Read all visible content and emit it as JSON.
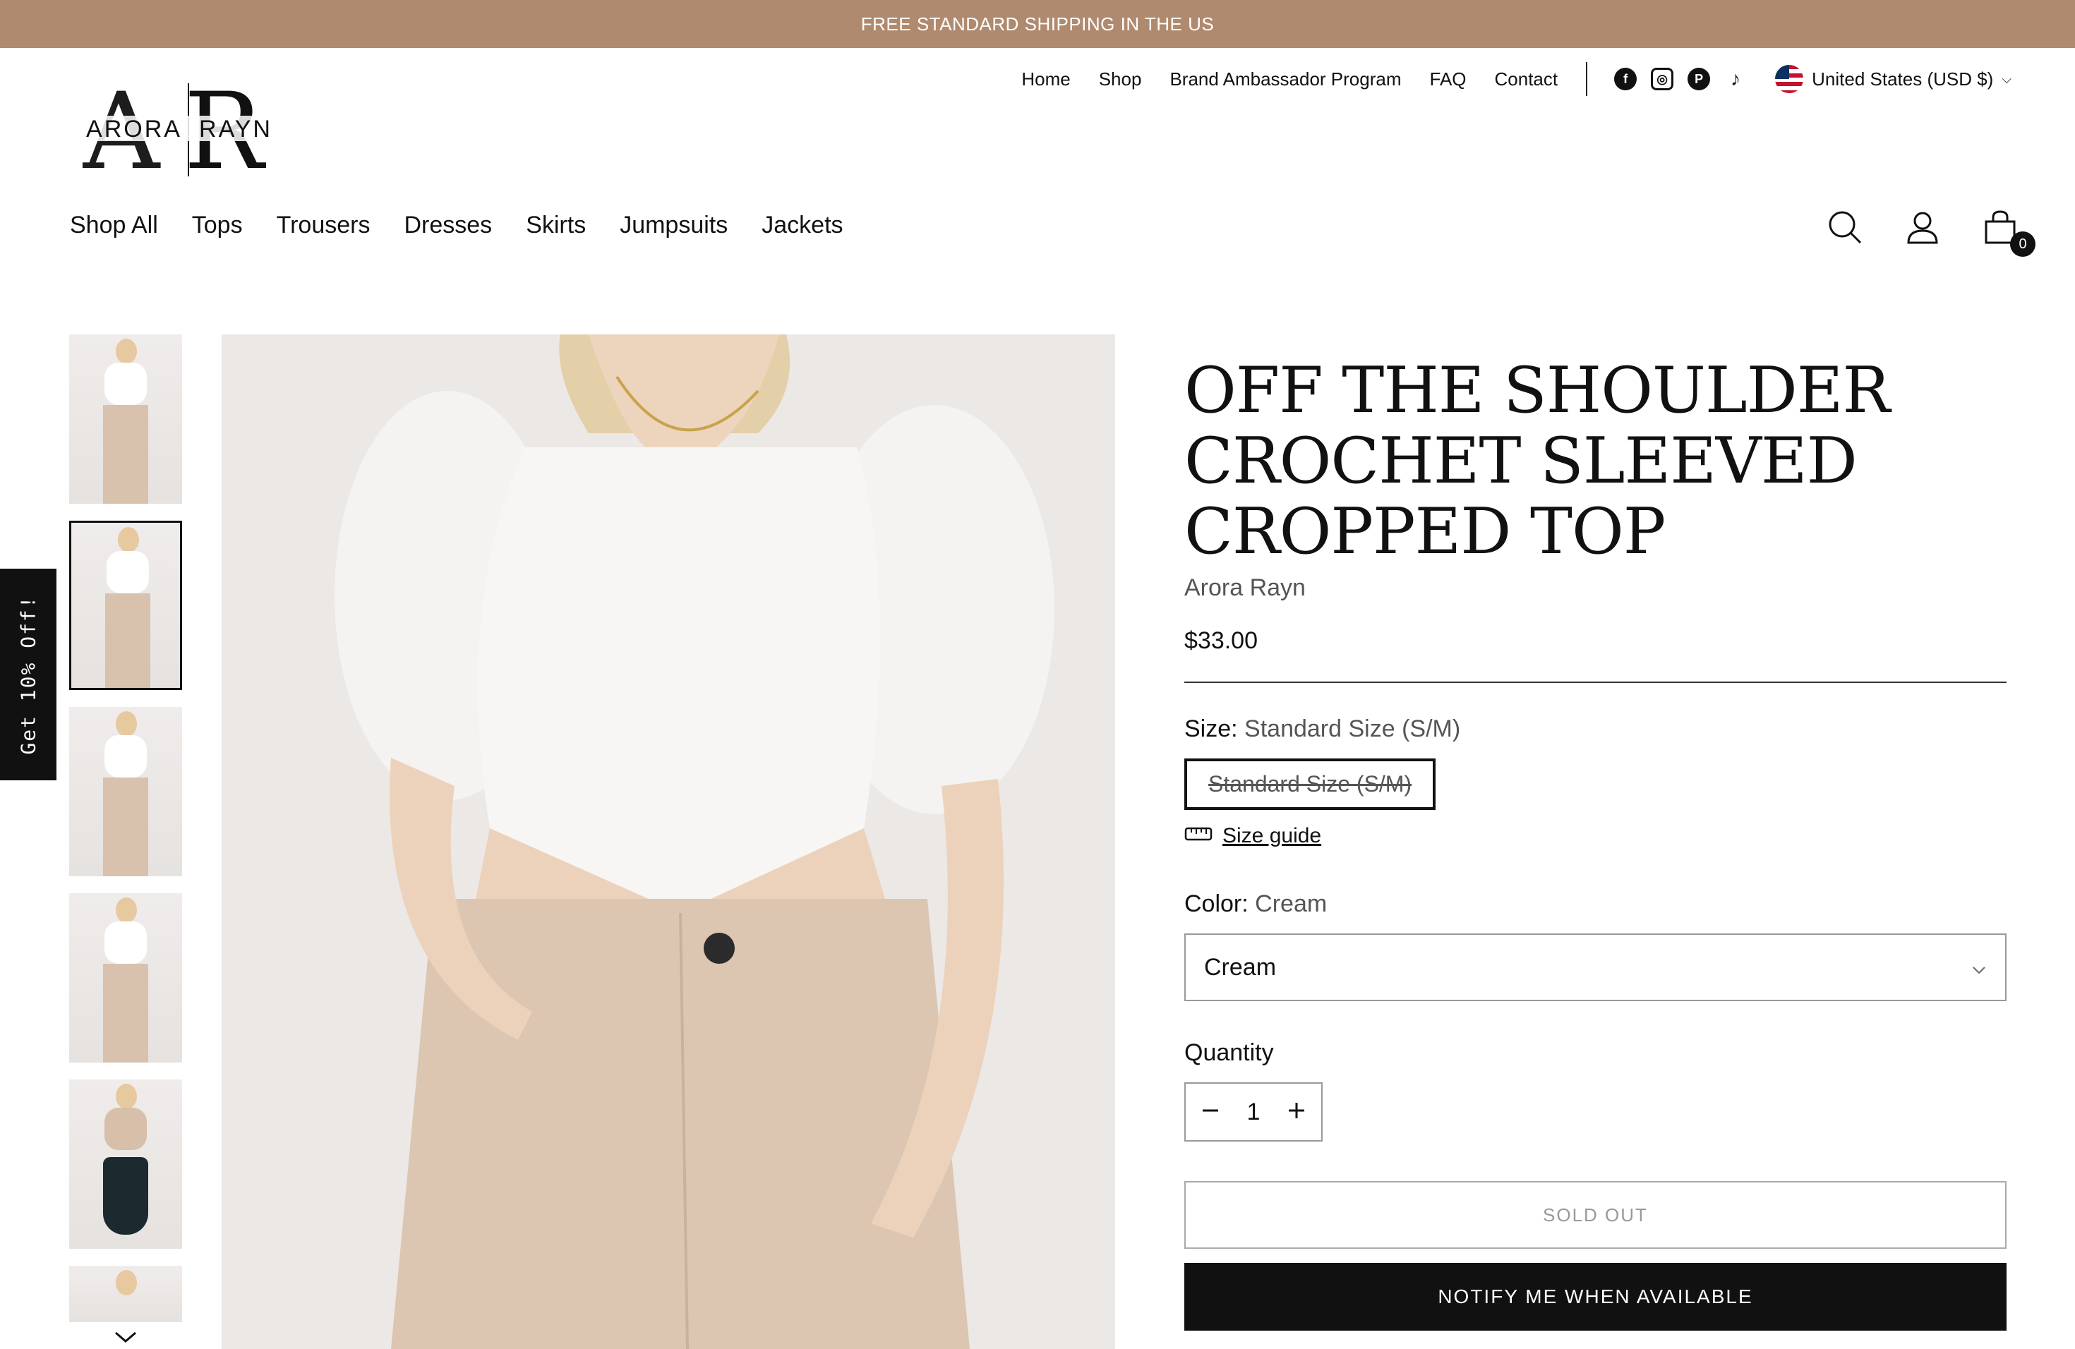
{
  "announcement": "FREE STANDARD SHIPPING IN THE US",
  "logo": {
    "left_text": "ARORA",
    "right_text": "RAYN"
  },
  "top_nav": [
    "Home",
    "Shop",
    "Brand Ambassador Program",
    "FAQ",
    "Contact"
  ],
  "social_icons": [
    "facebook-icon",
    "instagram-icon",
    "pinterest-icon",
    "tiktok-icon"
  ],
  "currency": "United States (USD $)",
  "main_nav": [
    "Shop All",
    "Tops",
    "Trousers",
    "Dresses",
    "Skirts",
    "Jumpsuits",
    "Jackets"
  ],
  "cart": {
    "count": "0"
  },
  "promo_tab": "Get 10% Off!",
  "product": {
    "title": "OFF THE SHOULDER CROCHET SLEEVED CROPPED TOP",
    "vendor": "Arora Rayn",
    "price": "$33.00",
    "size_label": "Size:",
    "size_value": "Standard Size (S/M)",
    "size_option": "Standard Size (S/M)",
    "size_guide": "Size guide",
    "color_label": "Color:",
    "color_value": "Cream",
    "color_select": "Cream",
    "quantity_label": "Quantity",
    "quantity_value": "1",
    "sold_out": "SOLD OUT",
    "notify": "NOTIFY ME WHEN AVAILABLE"
  },
  "colors": {
    "announcement_bg": "#b08a6e",
    "button_dark": "#111111"
  }
}
